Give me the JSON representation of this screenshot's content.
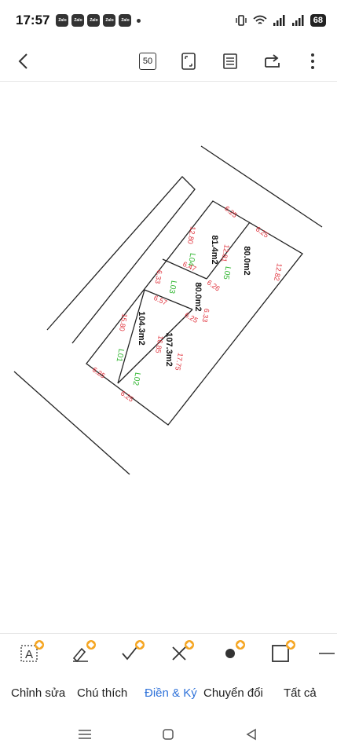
{
  "status_bar": {
    "time": "17:57",
    "app_badges": [
      "Zalo",
      "Zalo",
      "Zalo",
      "Zalo",
      "Zalo"
    ],
    "battery": "68",
    "icons": [
      "vibrate-icon",
      "wifi-icon",
      "signal-icon",
      "signal-icon",
      "battery-icon"
    ]
  },
  "toolbar": {
    "back_icon": "back-arrow-icon",
    "page_count": "50",
    "icons": [
      "page-count-icon",
      "fullscreen-icon",
      "outline-icon",
      "share-icon",
      "more-icon"
    ]
  },
  "plan": {
    "lots": [
      {
        "id": "L01",
        "area": "104.3m2"
      },
      {
        "id": "L02",
        "area": "107.3m2"
      },
      {
        "id": "L03",
        "area": "80.0m2"
      },
      {
        "id": "L04",
        "area": "81.4m2"
      },
      {
        "id": "L05",
        "area": "80.0m2"
      }
    ],
    "dimensions": [
      "6.25",
      "6.25",
      "6.25",
      "6.25",
      "6.25",
      "6.25",
      "6.26",
      "6.47",
      "6.57",
      "6.33",
      "6.33",
      "12.80",
      "12.81",
      "12.82",
      "15.80",
      "16.85",
      "17.75"
    ]
  },
  "bottom_tools": {
    "icons": [
      "text-box-icon",
      "pen-sign-icon",
      "checkmark-icon",
      "cross-icon",
      "dot-icon",
      "rectangle-icon",
      "line-icon"
    ]
  },
  "tabs": [
    "Chỉnh sửa",
    "Chú thích",
    "Điền & Ký",
    "Chuyển đổi",
    "Tất cả"
  ],
  "active_tab": "Điền & Ký",
  "accent_color": "#2f72d9",
  "nav": [
    "menu-icon",
    "home-icon",
    "back-icon"
  ]
}
